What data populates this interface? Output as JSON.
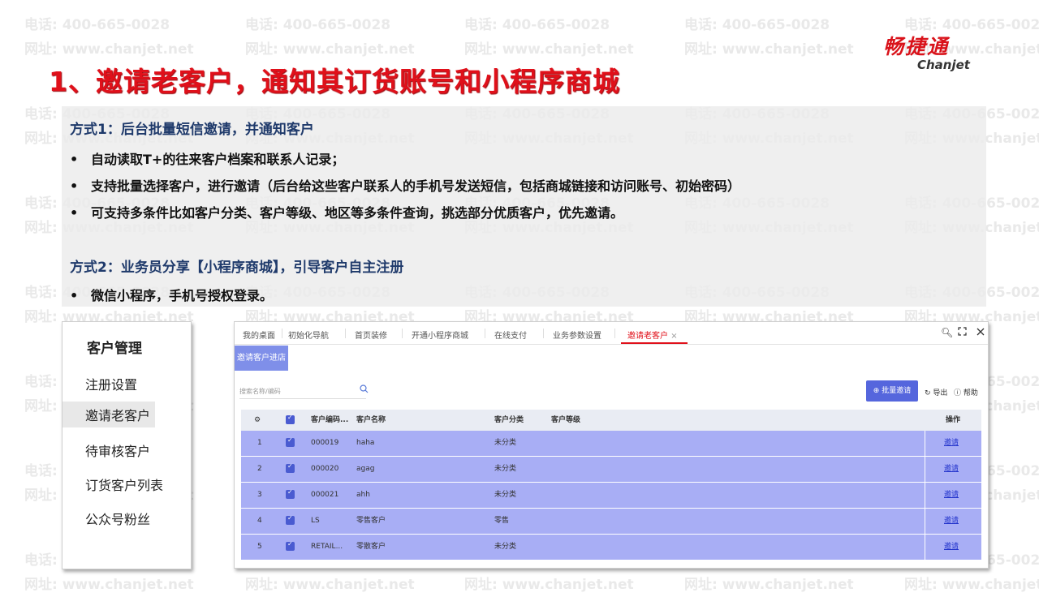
{
  "watermark": {
    "phone": "电话: 400-665-0028",
    "site": "网址: www.chanjet.net"
  },
  "logo": {
    "cn": "畅捷通",
    "en": "Chanjet"
  },
  "title": "1、邀请老客户，通知其订货账号和小程序商城",
  "method1": {
    "heading": "方式1：后台批量短信邀请，并通知客户",
    "bullets": [
      "自动读取T+的往来客户档案和联系人记录；",
      "支持批量选择客户，进行邀请（后台给这些客户联系人的手机号发送短信，包括商城链接和访问账号、初始密码）",
      "可支持多条件比如客户分类、客户等级、地区等多条件查询，挑选部分优质客户，优先邀请。"
    ]
  },
  "method2": {
    "heading": "方式2：业务员分享【小程序商城】，引导客户自主注册",
    "bullets": [
      "微信小程序，手机号授权登录。"
    ]
  },
  "menu": {
    "header": "客户管理",
    "items": [
      "注册设置",
      "邀请老客户",
      "待审核客户",
      "订货客户列表",
      "公众号粉丝"
    ],
    "active_index": 1
  },
  "app": {
    "tabs": [
      "我的桌面",
      "初始化导航",
      "首页装修",
      "开通小程序商城",
      "在线支付",
      "业务参数设置",
      "邀请老客户"
    ],
    "active_tab": "邀请老客户",
    "tab_close": "×",
    "window_icons": [
      "search-icon",
      "expand-icon",
      "close-icon"
    ],
    "side_button": "邀请客户进店",
    "search_placeholder": "搜索名称/编码",
    "bulk_invite": "批量邀请",
    "export": "导出",
    "help": "帮助",
    "columns": [
      "客户编码...",
      "客户名称",
      "客户分类",
      "客户等级",
      "操作"
    ],
    "rows": [
      {
        "no": "1",
        "code": "000019",
        "name": "haha",
        "category": "未分类",
        "level": "",
        "action": "邀请"
      },
      {
        "no": "2",
        "code": "000020",
        "name": "agag",
        "category": "未分类",
        "level": "",
        "action": "邀请"
      },
      {
        "no": "3",
        "code": "000021",
        "name": "ahh",
        "category": "未分类",
        "level": "",
        "action": "邀请"
      },
      {
        "no": "4",
        "code": "LS",
        "name": "零售客户",
        "category": "零售",
        "level": "",
        "action": "邀请"
      },
      {
        "no": "5",
        "code": "RETAIL...",
        "name": "零散客户",
        "category": "未分类",
        "level": "",
        "action": "邀请"
      }
    ]
  },
  "colors": {
    "title_red": "#e0101a",
    "heading_blue": "#1f3a6b",
    "row_purple": "#a8aef5",
    "accent": "#5566dd"
  }
}
